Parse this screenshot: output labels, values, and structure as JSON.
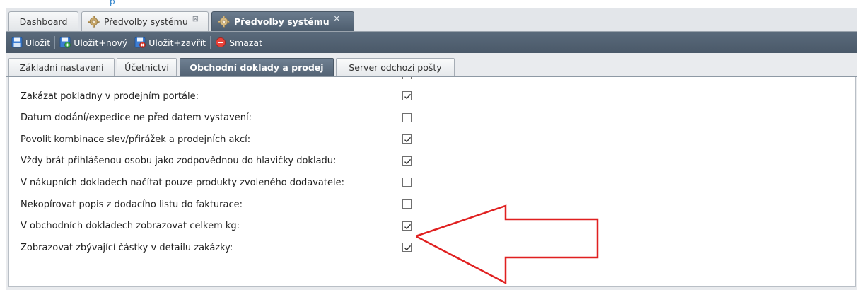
{
  "tabs": [
    {
      "label": "Dashboard",
      "active": false,
      "icon": null,
      "closable": false
    },
    {
      "label": "Předvolby systému",
      "active": false,
      "icon": "gear-icon",
      "closable": true
    },
    {
      "label": "Předvolby systému",
      "active": true,
      "icon": "gear-icon",
      "closable": true
    }
  ],
  "toolbar": {
    "save": "Uložit",
    "save_new": "Uložit+nový",
    "save_close": "Uložit+zavřít",
    "delete": "Smazat"
  },
  "subtabs": [
    {
      "label": "Základní nastavení",
      "active": false
    },
    {
      "label": "Účetnictví",
      "active": false
    },
    {
      "label": "Obchodní doklady a prodej",
      "active": true
    },
    {
      "label": "Server odchozí pošty",
      "active": false
    }
  ],
  "settings": [
    {
      "label": "Zakázat pokladny v prodejním portále:",
      "checked": true
    },
    {
      "label": "Datum dodání/expedice ne před datem vystavení:",
      "checked": false
    },
    {
      "label": "Povolit kombinace slev/přirážek a prodejních akcí:",
      "checked": true
    },
    {
      "label": "Vždy brát přihlášenou osobu jako zodpovědnou do hlavičky dokladu:",
      "checked": true
    },
    {
      "label": "V nákupních dokladech načítat pouze produkty zvoleného dodavatele:",
      "checked": false
    },
    {
      "label": "Nekopírovat popis z dodacího listu do fakturace:",
      "checked": false
    },
    {
      "label": "V obchodních dokladech zobrazovat celkem kg:",
      "checked": true
    },
    {
      "label": "Zobrazovat zbývající částky v detailu zakázky:",
      "checked": true
    }
  ],
  "colors": {
    "active_tab": "#5a6a7b",
    "annotation_arrow": "#e02020",
    "link_fragment": "#2a7fc9"
  }
}
